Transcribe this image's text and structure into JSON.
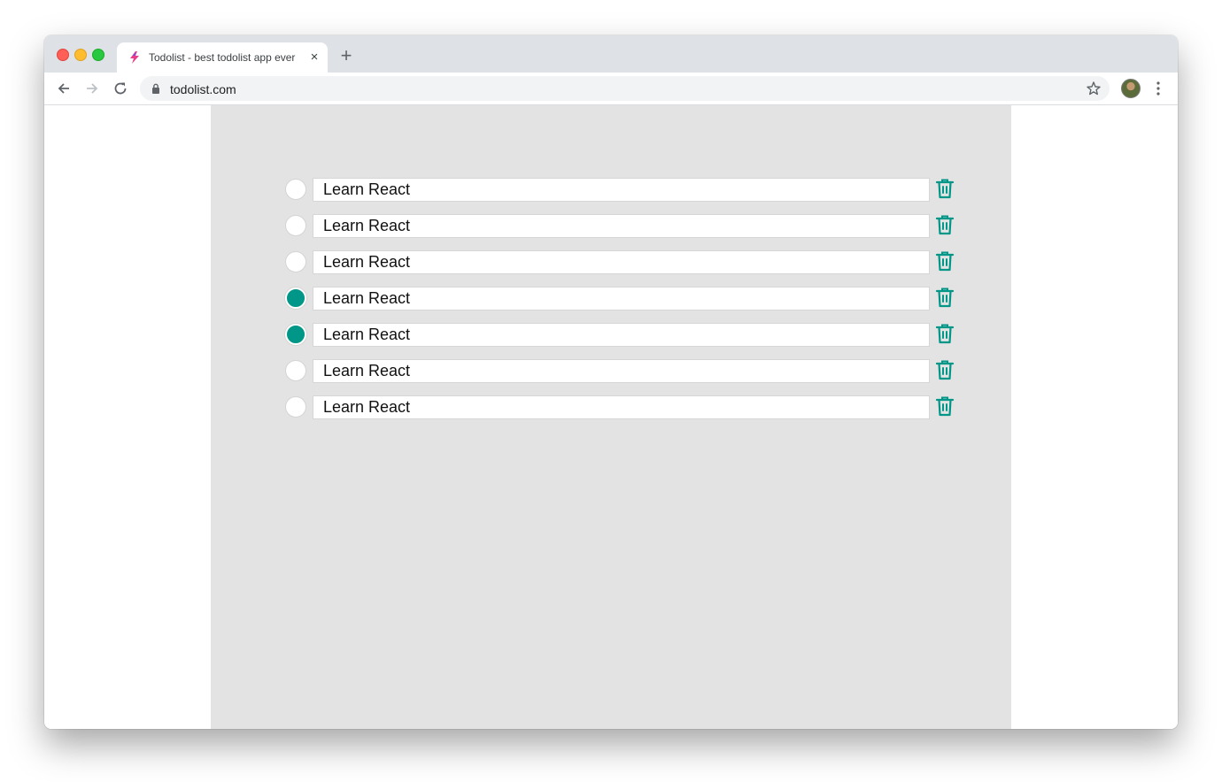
{
  "browser": {
    "tab_title": "Todolist - best todolist app ever",
    "tab_close": "×",
    "new_tab": "+",
    "url": "todolist.com"
  },
  "colors": {
    "accent": "#009688",
    "panel_bg": "#e3e3e3",
    "tab_strip": "#dee1e6"
  },
  "todos": [
    {
      "text": "Learn React",
      "completed": false
    },
    {
      "text": "Learn React",
      "completed": false
    },
    {
      "text": "Learn React",
      "completed": false
    },
    {
      "text": "Learn React",
      "completed": true
    },
    {
      "text": "Learn React",
      "completed": true
    },
    {
      "text": "Learn React",
      "completed": false
    },
    {
      "text": "Learn React",
      "completed": false
    }
  ],
  "icons": {
    "complete_toggle": "circle-check-icon",
    "delete": "trash-icon"
  }
}
